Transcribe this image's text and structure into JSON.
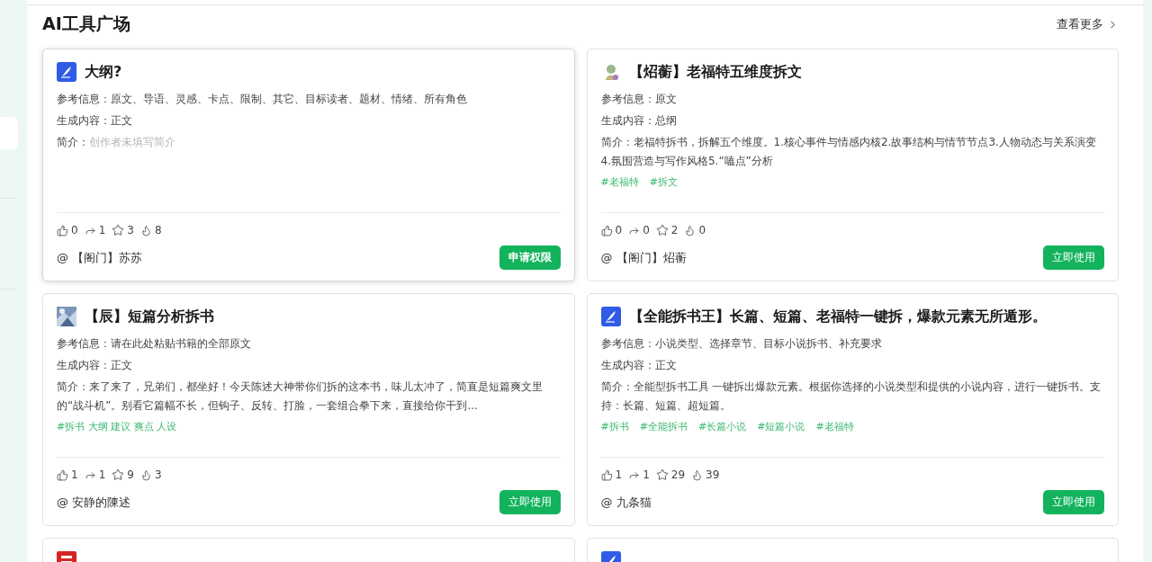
{
  "page_title": "AI工具广场",
  "more_link": "查看更多",
  "cards": [
    {
      "kind": "quill",
      "title": "大纲?",
      "highlighted": true,
      "reference": {
        "label": "参考信息：",
        "value": "原文、导语、灵感、卡点、限制、其它、目标读者、题材、情绪、所有角色"
      },
      "output": {
        "label": "生成内容：",
        "value": "正文"
      },
      "intro": {
        "label": "简介：",
        "value": "创作者未填写简介",
        "muted": true
      },
      "stats": {
        "likes": "0",
        "shares": "1",
        "stars": "3",
        "heat": "8"
      },
      "author": "@ 【阁门】苏苏",
      "action": "申请权限"
    },
    {
      "kind": "avatar",
      "title": "【炤蘅】老福特五维度拆文",
      "highlighted": false,
      "reference": {
        "label": "参考信息：",
        "value": "原文"
      },
      "output": {
        "label": "生成内容：",
        "value": "总纲"
      },
      "intro": {
        "label": "简介：",
        "value": "老福特拆书，拆解五个维度。1.核心事件与情感内核2.故事结构与情节节点3.人物动态与关系演变4.氛围营造与写作风格5.“嗑点”分析",
        "muted": false
      },
      "tags": [
        "#老福特",
        "#拆文"
      ],
      "stats": {
        "likes": "0",
        "shares": "0",
        "stars": "2",
        "heat": "0"
      },
      "author": "@ 【阁门】炤蘅",
      "action": "立即使用"
    },
    {
      "kind": "picture",
      "title": "【辰】短篇分析拆书",
      "highlighted": false,
      "reference": {
        "label": "参考信息：",
        "value": "请在此处粘贴书籍的全部原文"
      },
      "output": {
        "label": "生成内容：",
        "value": "正文"
      },
      "intro": {
        "label": "简介：",
        "value": "来了来了，兄弟们，都坐好！今天陈述大神带你们拆的这本书，味儿太冲了，简直是短篇爽文里的“战斗机”。别看它篇幅不长，但钩子、反转、打脸，一套组合拳下来，直接给你干到...",
        "muted": false
      },
      "tags": [
        "#拆书 大纲 建议 爽点 人设"
      ],
      "stats": {
        "likes": "1",
        "shares": "1",
        "stars": "9",
        "heat": "3"
      },
      "author": "@ 安静的陳述",
      "action": "立即使用"
    },
    {
      "kind": "quill",
      "title": "【全能拆书王】长篇、短篇、老福特一键拆，爆款元素无所遁形。",
      "highlighted": false,
      "reference": {
        "label": "参考信息：",
        "value": "小说类型、选择章节、目标小说拆书、补充要求"
      },
      "output": {
        "label": "生成内容：",
        "value": "正文"
      },
      "intro": {
        "label": "简介：",
        "value": "全能型拆书工具 一键拆出爆款元素。根据你选择的小说类型和提供的小说内容，进行一键拆书。支持：长篇、短篇、超短篇。",
        "muted": false
      },
      "tags": [
        "#拆书",
        "#全能拆书",
        "#长篇小说",
        "#短篇小说",
        "#老福特"
      ],
      "stats": {
        "likes": "1",
        "shares": "1",
        "stars": "29",
        "heat": "39"
      },
      "author": "@ 九条猫",
      "action": "立即使用"
    },
    {
      "kind": "seal"
    },
    {
      "kind": "quill"
    }
  ]
}
